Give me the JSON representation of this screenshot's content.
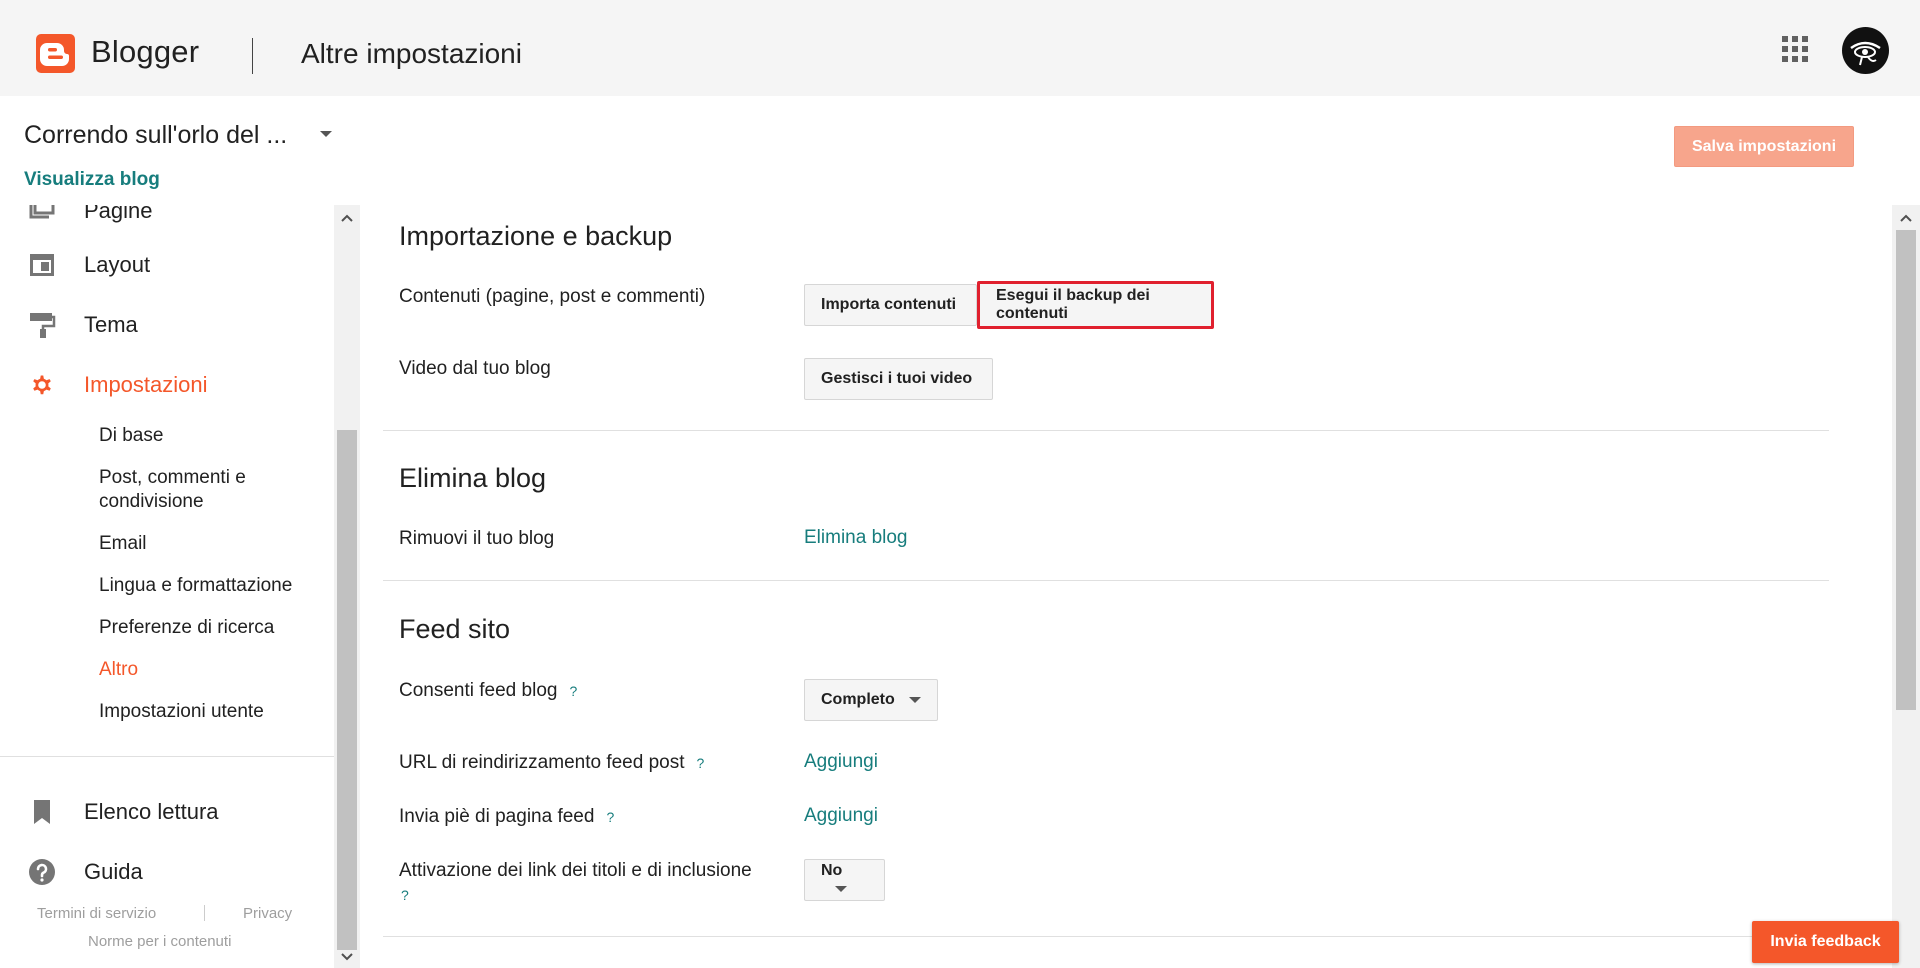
{
  "header": {
    "brand": "Blogger",
    "page_title": "Altre impostazioni"
  },
  "blog": {
    "name": "Correndo sull'orlo del ...",
    "view_link": "Visualizza blog"
  },
  "actions": {
    "save_label": "Salva impostazioni",
    "feedback_label": "Invia feedback"
  },
  "sidebar": {
    "items": [
      {
        "label": "Pagine",
        "icon": "pages-icon"
      },
      {
        "label": "Layout",
        "icon": "layout-icon"
      },
      {
        "label": "Tema",
        "icon": "theme-paint-roller-icon"
      },
      {
        "label": "Impostazioni",
        "icon": "gear-icon",
        "active": true
      }
    ],
    "subitems": [
      "Di base",
      "Post, commenti e condivisione",
      "Email",
      "Lingua e formattazione",
      "Preferenze di ricerca",
      "Altro",
      "Impostazioni utente"
    ],
    "active_subitem": "Altro",
    "bottom_items": [
      {
        "label": "Elenco lettura",
        "icon": "bookmark-icon"
      },
      {
        "label": "Guida",
        "icon": "help-icon"
      }
    ],
    "footer": {
      "terms": "Termini di servizio",
      "privacy": "Privacy",
      "content_policy": "Norme per i contenuti"
    }
  },
  "main": {
    "import_backup": {
      "title": "Importazione e backup",
      "content_label": "Contenuti (pagine, post e commenti)",
      "import_button": "Importa contenuti",
      "backup_button": "Esegui il backup dei contenuti",
      "video_label": "Video dal tuo blog",
      "video_button": "Gestisci i tuoi video"
    },
    "delete_blog": {
      "title": "Elimina blog",
      "remove_label": "Rimuovi il tuo blog",
      "delete_link": "Elimina blog"
    },
    "site_feed": {
      "title": "Feed sito",
      "allow_feed_label": "Consenti feed blog",
      "allow_feed_value": "Completo",
      "redirect_label": "URL di reindirizzamento feed post",
      "redirect_link": "Aggiungi",
      "footer_label": "Invia piè di pagina feed",
      "footer_link": "Aggiungi",
      "title_links_label": "Attivazione dei link dei titoli e di inclusione",
      "title_links_value": "No",
      "help_mark": "?"
    }
  },
  "colors": {
    "accent": "#f4572a",
    "link": "#177d7d",
    "highlight": "#e0202e"
  }
}
